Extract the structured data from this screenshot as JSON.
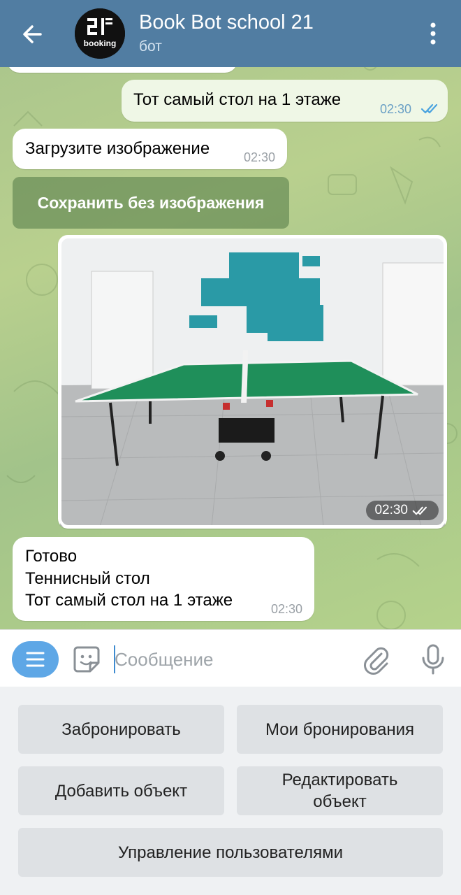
{
  "header": {
    "title": "Book Bot school 21",
    "subtitle": "бот",
    "avatar_text_top": "21",
    "avatar_text_bottom": "booking"
  },
  "messages": {
    "out_text": "Тот самый стол на 1 этаже",
    "out_time": "02:30",
    "in1_text": "Загрузите изображение",
    "in1_time": "02:30",
    "inline_button": "Сохранить без изображения",
    "photo_time": "02:30",
    "final_line1": "Готово",
    "final_line2": "Теннисный стол",
    "final_line3": "Тот самый стол на 1 этаже",
    "final_time": "02:30"
  },
  "composer": {
    "placeholder": "Сообщение"
  },
  "keyboard": {
    "book": "Забронировать",
    "my_bookings": "Мои бронирования",
    "add_object": "Добавить объект",
    "edit_object": "Редактировать объект",
    "manage_users": "Управление пользователями"
  },
  "colors": {
    "header": "#517da2",
    "accent": "#5ea7e6",
    "out_bubble": "#eff7e6"
  }
}
